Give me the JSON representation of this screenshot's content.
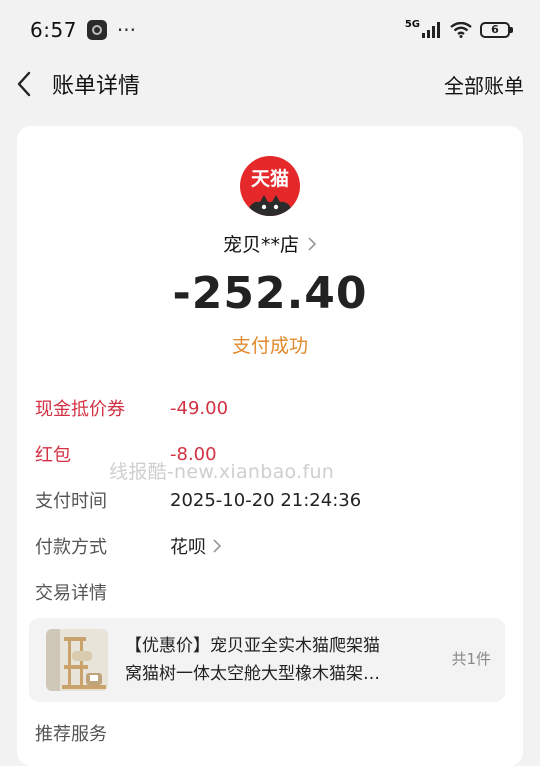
{
  "status_bar": {
    "time": "6:57",
    "dots": "···",
    "network": "5G",
    "battery": "6"
  },
  "nav": {
    "title": "账单详情",
    "action": "全部账单"
  },
  "merchant": {
    "logo_text": "天猫",
    "name": "宠贝**店",
    "amount": "-252.40",
    "status": "支付成功"
  },
  "details": [
    {
      "label": "现金抵价券",
      "value": "-49.00"
    },
    {
      "label": "红包",
      "value": "-8.00"
    },
    {
      "label": "支付时间",
      "value": "2025-10-20 21:24:36"
    },
    {
      "label": "付款方式",
      "value": "花呗"
    },
    {
      "label": "交易详情",
      "value": ""
    }
  ],
  "watermark": "线报酷-new.xianbao.fun",
  "product": {
    "title_line1": "【优惠价】宠贝亚全实木猫爬架猫",
    "title_line2": "窝猫树一体太空舱大型橡木猫架…",
    "count": "共1件"
  },
  "next_section": "推荐服务",
  "colors": {
    "discount_red": "#d23244",
    "status_orange": "#e08a2c",
    "tmall_red": "#e5292b"
  }
}
